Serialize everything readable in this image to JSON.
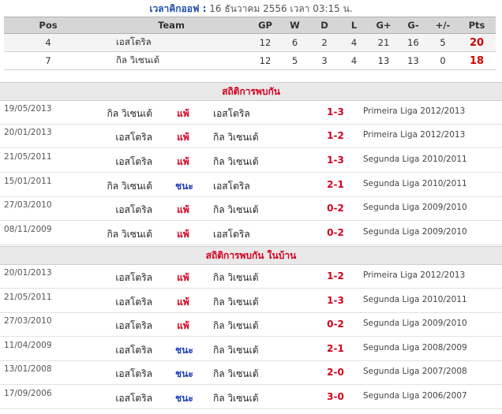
{
  "kickoff": {
    "label": "เวลาคิกออฟ :",
    "value": "16 ธันวาคม 2556 เวลา 03:15 น."
  },
  "standings": {
    "headers": {
      "pos": "Pos",
      "team": "Team",
      "gp": "GP",
      "w": "W",
      "d": "D",
      "l": "L",
      "gf": "G+",
      "ga": "G-",
      "diff": "+/-",
      "pts": "Pts"
    },
    "rows": [
      {
        "pos": "4",
        "team": "เอสโตริล",
        "gp": "12",
        "w": "6",
        "d": "2",
        "l": "4",
        "gf": "21",
        "ga": "16",
        "diff": "5",
        "pts": "20"
      },
      {
        "pos": "7",
        "team": "กิล วิเซนเต้",
        "gp": "12",
        "w": "5",
        "d": "3",
        "l": "4",
        "gf": "13",
        "ga": "13",
        "diff": "0",
        "pts": "18"
      }
    ]
  },
  "h2h": {
    "title": "สถิติการพบกัน",
    "matches": [
      {
        "date": "19/05/2013",
        "home": "กิล วิเซนเต้",
        "result": "แพ้",
        "away": "เอสโตริล",
        "score": "1-3",
        "competition": "Primeira Liga 2012/2013"
      },
      {
        "date": "20/01/2013",
        "home": "เอสโตริล",
        "result": "แพ้",
        "away": "กิล วิเซนเต้",
        "score": "1-2",
        "competition": "Primeira Liga 2012/2013"
      },
      {
        "date": "21/05/2011",
        "home": "เอสโตริล",
        "result": "แพ้",
        "away": "กิล วิเซนเต้",
        "score": "1-3",
        "competition": "Segunda Liga 2010/2011"
      },
      {
        "date": "15/01/2011",
        "home": "กิล วิเซนเต้",
        "result": "ชนะ",
        "away": "เอสโตริล",
        "score": "2-1",
        "competition": "Segunda Liga 2010/2011"
      },
      {
        "date": "27/03/2010",
        "home": "เอสโตริล",
        "result": "แพ้",
        "away": "กิล วิเซนเต้",
        "score": "0-2",
        "competition": "Segunda Liga 2009/2010"
      },
      {
        "date": "08/11/2009",
        "home": "กิล วิเซนเต้",
        "result": "แพ้",
        "away": "เอสโตริล",
        "score": "0-2",
        "competition": "Segunda Liga 2009/2010"
      }
    ]
  },
  "h2h_home": {
    "title": "สถิติการพบกัน ในบ้าน",
    "matches": [
      {
        "date": "20/01/2013",
        "home": "เอสโตริล",
        "result": "แพ้",
        "away": "กิล วิเซนเต้",
        "score": "1-2",
        "competition": "Primeira Liga 2012/2013"
      },
      {
        "date": "21/05/2011",
        "home": "เอสโตริล",
        "result": "แพ้",
        "away": "กิล วิเซนเต้",
        "score": "1-3",
        "competition": "Segunda Liga 2010/2011"
      },
      {
        "date": "27/03/2010",
        "home": "เอสโตริล",
        "result": "แพ้",
        "away": "กิล วิเซนเต้",
        "score": "0-2",
        "competition": "Segunda Liga 2009/2010"
      },
      {
        "date": "11/04/2009",
        "home": "เอสโตริล",
        "result": "ชนะ",
        "away": "กิล วิเซนเต้",
        "score": "2-1",
        "competition": "Segunda Liga 2008/2009"
      },
      {
        "date": "13/01/2008",
        "home": "เอสโตริล",
        "result": "ชนะ",
        "away": "กิล วิเซนเต้",
        "score": "2-0",
        "competition": "Segunda Liga 2007/2008"
      },
      {
        "date": "17/09/2006",
        "home": "เอสโตริล",
        "result": "ชนะ",
        "away": "กิล วิเซนเต้",
        "score": "3-0",
        "competition": "Segunda Liga 2006/2007"
      }
    ]
  },
  "colors": {
    "loss": "#d4001f",
    "win": "#1f3fb8",
    "section_title": "#d4001f",
    "points": "#d00000"
  }
}
